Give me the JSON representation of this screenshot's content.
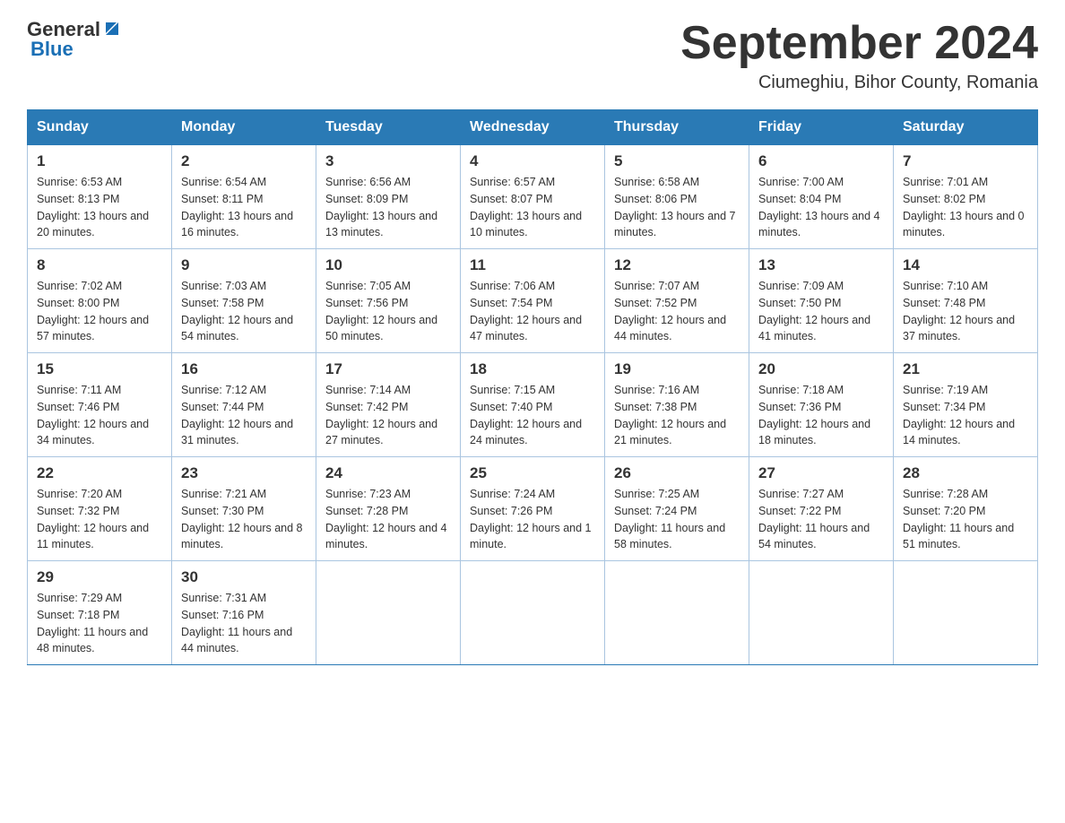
{
  "header": {
    "logo_general": "General",
    "logo_blue": "Blue",
    "title": "September 2024",
    "subtitle": "Ciumeghiu, Bihor County, Romania"
  },
  "days_of_week": [
    "Sunday",
    "Monday",
    "Tuesday",
    "Wednesday",
    "Thursday",
    "Friday",
    "Saturday"
  ],
  "weeks": [
    [
      {
        "day": "1",
        "sunrise": "6:53 AM",
        "sunset": "8:13 PM",
        "daylight": "13 hours and 20 minutes."
      },
      {
        "day": "2",
        "sunrise": "6:54 AM",
        "sunset": "8:11 PM",
        "daylight": "13 hours and 16 minutes."
      },
      {
        "day": "3",
        "sunrise": "6:56 AM",
        "sunset": "8:09 PM",
        "daylight": "13 hours and 13 minutes."
      },
      {
        "day": "4",
        "sunrise": "6:57 AM",
        "sunset": "8:07 PM",
        "daylight": "13 hours and 10 minutes."
      },
      {
        "day": "5",
        "sunrise": "6:58 AM",
        "sunset": "8:06 PM",
        "daylight": "13 hours and 7 minutes."
      },
      {
        "day": "6",
        "sunrise": "7:00 AM",
        "sunset": "8:04 PM",
        "daylight": "13 hours and 4 minutes."
      },
      {
        "day": "7",
        "sunrise": "7:01 AM",
        "sunset": "8:02 PM",
        "daylight": "13 hours and 0 minutes."
      }
    ],
    [
      {
        "day": "8",
        "sunrise": "7:02 AM",
        "sunset": "8:00 PM",
        "daylight": "12 hours and 57 minutes."
      },
      {
        "day": "9",
        "sunrise": "7:03 AM",
        "sunset": "7:58 PM",
        "daylight": "12 hours and 54 minutes."
      },
      {
        "day": "10",
        "sunrise": "7:05 AM",
        "sunset": "7:56 PM",
        "daylight": "12 hours and 50 minutes."
      },
      {
        "day": "11",
        "sunrise": "7:06 AM",
        "sunset": "7:54 PM",
        "daylight": "12 hours and 47 minutes."
      },
      {
        "day": "12",
        "sunrise": "7:07 AM",
        "sunset": "7:52 PM",
        "daylight": "12 hours and 44 minutes."
      },
      {
        "day": "13",
        "sunrise": "7:09 AM",
        "sunset": "7:50 PM",
        "daylight": "12 hours and 41 minutes."
      },
      {
        "day": "14",
        "sunrise": "7:10 AM",
        "sunset": "7:48 PM",
        "daylight": "12 hours and 37 minutes."
      }
    ],
    [
      {
        "day": "15",
        "sunrise": "7:11 AM",
        "sunset": "7:46 PM",
        "daylight": "12 hours and 34 minutes."
      },
      {
        "day": "16",
        "sunrise": "7:12 AM",
        "sunset": "7:44 PM",
        "daylight": "12 hours and 31 minutes."
      },
      {
        "day": "17",
        "sunrise": "7:14 AM",
        "sunset": "7:42 PM",
        "daylight": "12 hours and 27 minutes."
      },
      {
        "day": "18",
        "sunrise": "7:15 AM",
        "sunset": "7:40 PM",
        "daylight": "12 hours and 24 minutes."
      },
      {
        "day": "19",
        "sunrise": "7:16 AM",
        "sunset": "7:38 PM",
        "daylight": "12 hours and 21 minutes."
      },
      {
        "day": "20",
        "sunrise": "7:18 AM",
        "sunset": "7:36 PM",
        "daylight": "12 hours and 18 minutes."
      },
      {
        "day": "21",
        "sunrise": "7:19 AM",
        "sunset": "7:34 PM",
        "daylight": "12 hours and 14 minutes."
      }
    ],
    [
      {
        "day": "22",
        "sunrise": "7:20 AM",
        "sunset": "7:32 PM",
        "daylight": "12 hours and 11 minutes."
      },
      {
        "day": "23",
        "sunrise": "7:21 AM",
        "sunset": "7:30 PM",
        "daylight": "12 hours and 8 minutes."
      },
      {
        "day": "24",
        "sunrise": "7:23 AM",
        "sunset": "7:28 PM",
        "daylight": "12 hours and 4 minutes."
      },
      {
        "day": "25",
        "sunrise": "7:24 AM",
        "sunset": "7:26 PM",
        "daylight": "12 hours and 1 minute."
      },
      {
        "day": "26",
        "sunrise": "7:25 AM",
        "sunset": "7:24 PM",
        "daylight": "11 hours and 58 minutes."
      },
      {
        "day": "27",
        "sunrise": "7:27 AM",
        "sunset": "7:22 PM",
        "daylight": "11 hours and 54 minutes."
      },
      {
        "day": "28",
        "sunrise": "7:28 AM",
        "sunset": "7:20 PM",
        "daylight": "11 hours and 51 minutes."
      }
    ],
    [
      {
        "day": "29",
        "sunrise": "7:29 AM",
        "sunset": "7:18 PM",
        "daylight": "11 hours and 48 minutes."
      },
      {
        "day": "30",
        "sunrise": "7:31 AM",
        "sunset": "7:16 PM",
        "daylight": "11 hours and 44 minutes."
      },
      null,
      null,
      null,
      null,
      null
    ]
  ]
}
